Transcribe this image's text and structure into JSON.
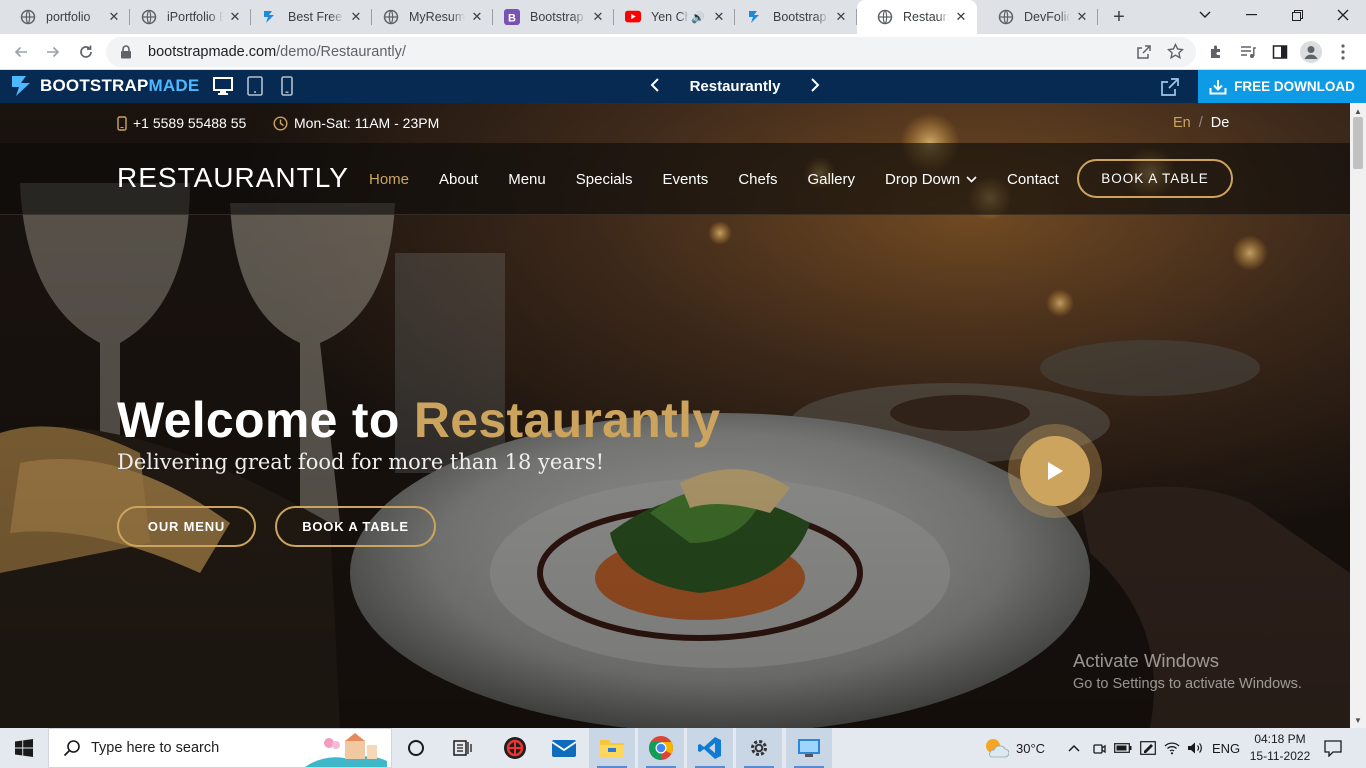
{
  "browser": {
    "tabs": [
      {
        "title": "portfolio",
        "active": false
      },
      {
        "title": "iPortfolio Bootstrap",
        "active": false
      },
      {
        "title": "Best Free Website",
        "active": false
      },
      {
        "title": "MyResume Bootstrap",
        "active": false
      },
      {
        "title": "Bootstrap Templates",
        "active": false
      },
      {
        "title": "Yen Chi",
        "active": false
      },
      {
        "title": "Bootstrap Templates",
        "active": false
      },
      {
        "title": "Restaurantly",
        "active": true
      },
      {
        "title": "DevFolio Bootstrap",
        "active": false
      }
    ],
    "url_host": "bootstrapmade.com",
    "url_path": "/demo/Restaurantly/"
  },
  "preview_bar": {
    "logo_bold": "BOOTSTRAP",
    "logo_light": "MADE",
    "template_name": "Restaurantly",
    "download_label": "FREE DOWNLOAD"
  },
  "site": {
    "phone": "+1 5589 55488 55",
    "hours": "Mon-Sat: 11AM - 23PM",
    "lang_en": "En",
    "lang_sep": "/",
    "lang_de": "De",
    "brand": "RESTAURANTLY",
    "nav": [
      "Home",
      "About",
      "Menu",
      "Specials",
      "Events",
      "Chefs",
      "Gallery",
      "Drop Down",
      "Contact"
    ],
    "book_table": "BOOK A TABLE",
    "hero": {
      "title_white": "Welcome to",
      "title_gold": "Restaurantly",
      "subtitle": "Delivering great food for more than 18 years!",
      "btn_menu": "OUR MENU",
      "btn_book": "BOOK A TABLE"
    },
    "accent_color": "#cda45e"
  },
  "watermark": {
    "line1": "Activate Windows",
    "line2": "Go to Settings to activate Windows."
  },
  "taskbar": {
    "search_placeholder": "Type here to search",
    "weather": "30°C",
    "lang": "ENG",
    "time": "04:18 PM",
    "date": "15-11-2022"
  }
}
